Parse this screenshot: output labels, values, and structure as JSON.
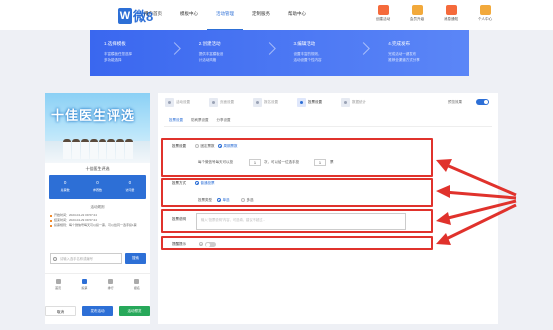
{
  "header": {
    "logo_mark": "W",
    "logo_text": "微8",
    "nav": [
      "用户首页",
      "模板中心",
      "活动管理",
      "定制服务",
      "帮助中心"
    ],
    "nav_active_index": 2,
    "right_items": [
      {
        "label": "创建活动",
        "icon": "create-icon",
        "color": "#f56a3b"
      },
      {
        "label": "会员升级",
        "icon": "vip-icon",
        "color": "#f2a93b"
      },
      {
        "label": "消息通知",
        "icon": "bell-icon",
        "color": "#f56a3b"
      },
      {
        "label": "个人中心",
        "icon": "user-icon",
        "color": "#f2a93b"
      }
    ]
  },
  "steps": [
    {
      "title": "1.选择模板",
      "desc": [
        "丰富模板任您选择",
        "多功能选择"
      ]
    },
    {
      "title": "2.创建活动",
      "desc": [
        "提供丰富模板设",
        "计活动风格"
      ]
    },
    {
      "title": "3.编辑活动",
      "desc": [
        "设置丰富的规则，",
        "活动设置个性内容"
      ]
    },
    {
      "title": "4.完成发布",
      "desc": [
        "完成活动一键发布",
        "推荐全渠道方式分享"
      ]
    }
  ],
  "phone": {
    "poster_title": "十佳医生评选",
    "activity_name": "十佳医生评选",
    "stats": [
      {
        "value": "0",
        "label": "总票数"
      },
      {
        "value": "0",
        "label": "参赛数"
      },
      {
        "value": "0",
        "label": "访问量"
      }
    ],
    "rules_title": "活动规则",
    "rules": [
      "开始时间：2023-04-22 09:57:24",
      "结束时间：2023-04-29 09:57:24",
      "投票规则：每个微信号每天可以投一票，可以给同一选手投1票"
    ],
    "search_placeholder": "请输入选手名称或编号",
    "search_button": "搜索",
    "tabs": [
      "首页",
      "投票",
      "排行",
      "报名"
    ],
    "tab_active_index": 1,
    "buttons": {
      "cancel": "取消",
      "publish": "发布活动",
      "preview": "活动预览"
    }
  },
  "panel": {
    "tabs": [
      "活动设置",
      "页面设置",
      "报名设置",
      "投票设置",
      "数据统计"
    ],
    "tab_active_index": 3,
    "preview_label": "预览效果",
    "subtabs": [
      "投票设置",
      "防刷票设置",
      "分享设置"
    ],
    "subtab_active_index": 0,
    "vote_limit": {
      "label": "投票设置",
      "options": [
        "固定票数",
        "周期票数"
      ],
      "selected": 1,
      "line_prefix": "每个微信号每天可以投",
      "count1": "1",
      "unit1": "次，可以给一位选手投",
      "count2": "1",
      "unit2": "票"
    },
    "vote_method": {
      "label": "投票方式",
      "option": "普通投票",
      "type_label": "投票类型",
      "type_options": [
        "单选",
        "多选"
      ],
      "type_selected": 0
    },
    "vote_desc": {
      "label": "投票说明",
      "placeholder": "输入“投票说明”内容，可选填，建议不超过..."
    },
    "reminder": {
      "label": "提醒提示",
      "help": "?"
    }
  },
  "colors": {
    "accent": "#2d6fd6",
    "highlight": "#e0322c",
    "success": "#27a85a"
  }
}
